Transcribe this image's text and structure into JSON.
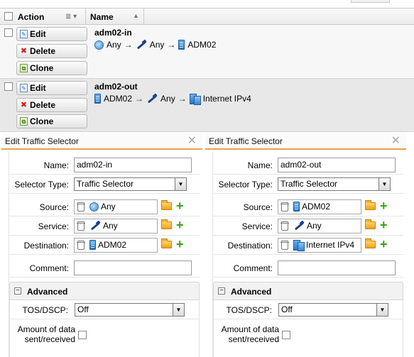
{
  "table": {
    "header": {
      "action": "Action",
      "name": "Name"
    },
    "rows": [
      {
        "buttons": {
          "edit": "Edit",
          "delete": "Delete",
          "clone": "Clone"
        },
        "name": "adm02-in",
        "source": "Any",
        "service": "Any",
        "destination": "ADM02",
        "arrow": "→"
      },
      {
        "buttons": {
          "edit": "Edit",
          "delete": "Delete",
          "clone": "Clone"
        },
        "name": "adm02-out",
        "source": "ADM02",
        "service": "Any",
        "destination": "Internet IPv4",
        "arrow": "→"
      }
    ]
  },
  "dialogs": [
    {
      "title": "Edit Traffic Selector",
      "close": "✕",
      "labels": {
        "name": "Name:",
        "selector_type": "Selector Type:",
        "source": "Source:",
        "service": "Service:",
        "destination": "Destination:",
        "comment": "Comment:",
        "advanced": "Advanced",
        "tos": "TOS/DSCP:",
        "amount_line1": "Amount of data",
        "amount_line2": "sent/received"
      },
      "values": {
        "name": "adm02-in",
        "selector_type": "Traffic Selector",
        "source": "Any",
        "service": "Any",
        "destination": "ADM02",
        "comment": "",
        "tos": "Off"
      }
    },
    {
      "title": "Edit Traffic Selector",
      "close": "✕",
      "labels": {
        "name": "Name:",
        "selector_type": "Selector Type:",
        "source": "Source:",
        "service": "Service:",
        "destination": "Destination:",
        "comment": "Comment:",
        "advanced": "Advanced",
        "tos": "TOS/DSCP:",
        "amount_line1": "Amount of data",
        "amount_line2": "sent/received"
      },
      "values": {
        "name": "adm02-out",
        "selector_type": "Traffic Selector",
        "source": "ADM02",
        "service": "Any",
        "destination": "Internet IPv4",
        "comment": "",
        "tos": "Off"
      }
    }
  ],
  "icons": {
    "checkbox": "checkbox-icon",
    "sort": "column-menu-icon",
    "edit": "edit-icon",
    "delete": "delete-icon",
    "clone": "clone-icon",
    "globe": "globe-icon",
    "service": "service-icon",
    "server": "server-icon",
    "network": "network-icon",
    "trash": "trash-icon",
    "folder": "folder-icon",
    "plus": "plus-icon"
  },
  "colors": {
    "accent": "#e8a24a",
    "add": "#3aa018",
    "delete": "#d0201b"
  }
}
